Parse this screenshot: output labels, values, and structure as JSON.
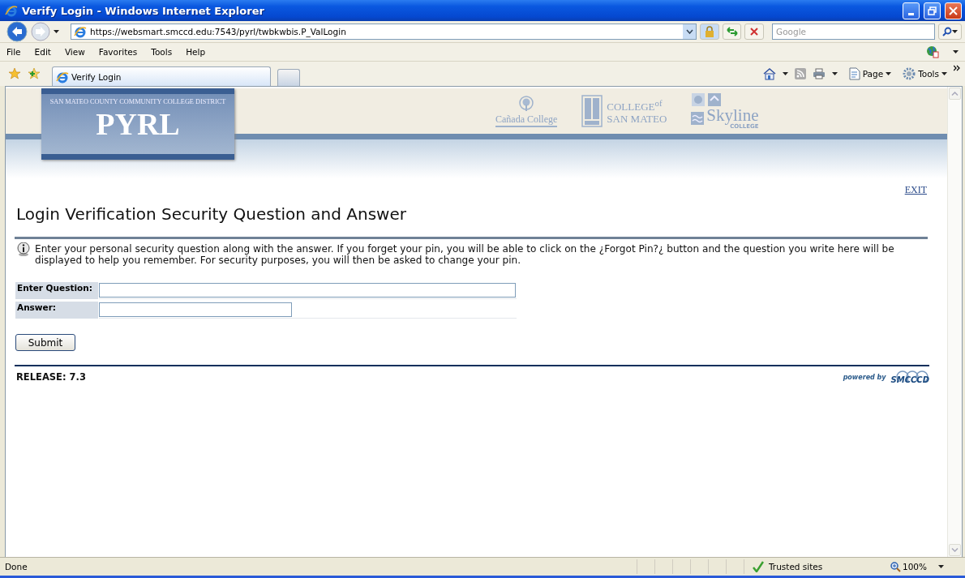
{
  "window": {
    "title": "Verify Login - Windows Internet Explorer"
  },
  "address_bar": {
    "url": "https://websmart.smccd.edu:7543/pyrl/twbkwbis.P_ValLogin"
  },
  "search": {
    "placeholder": "Google"
  },
  "menu": [
    "File",
    "Edit",
    "View",
    "Favorites",
    "Tools",
    "Help"
  ],
  "tabs": [
    {
      "label": "Verify Login",
      "selected": true
    }
  ],
  "command_bar": [
    "Page",
    "Tools"
  ],
  "page": {
    "banner": {
      "district": "SAN MATEO COUNTY COMMUNITY COLLEGE DISTRICT",
      "title": "PYRL"
    },
    "college_logos": [
      {
        "kind": "canada",
        "lines": [
          "Cañada College"
        ]
      },
      {
        "kind": "csm",
        "lines": [
          "COLLEGE$^{of}$",
          "SAN MATEO"
        ]
      },
      {
        "kind": "skyline",
        "lines": [
          "Skyline",
          "COLLEGE"
        ]
      }
    ],
    "exit_link": "EXIT",
    "heading": "Login Verification Security Question and Answer",
    "info": "Enter your personal security question along with the answer. If you forget your pin, you will be able to click on the ¿Forgot Pin?¿ button and the question you write here will be displayed to help you remember. For security purposes, you will then be asked to change your pin.",
    "fields": [
      {
        "label": "Enter Question:",
        "kind": "wide"
      },
      {
        "label": "Answer:",
        "kind": "narrow"
      }
    ],
    "submit": "Submit",
    "release": "RELEASE: 7.3",
    "powered_by": {
      "text": "powered by",
      "logo": "SMCCCD"
    }
  },
  "status_bar": {
    "text": "Done",
    "zone": "Trusted sites",
    "zoom": "100%"
  }
}
